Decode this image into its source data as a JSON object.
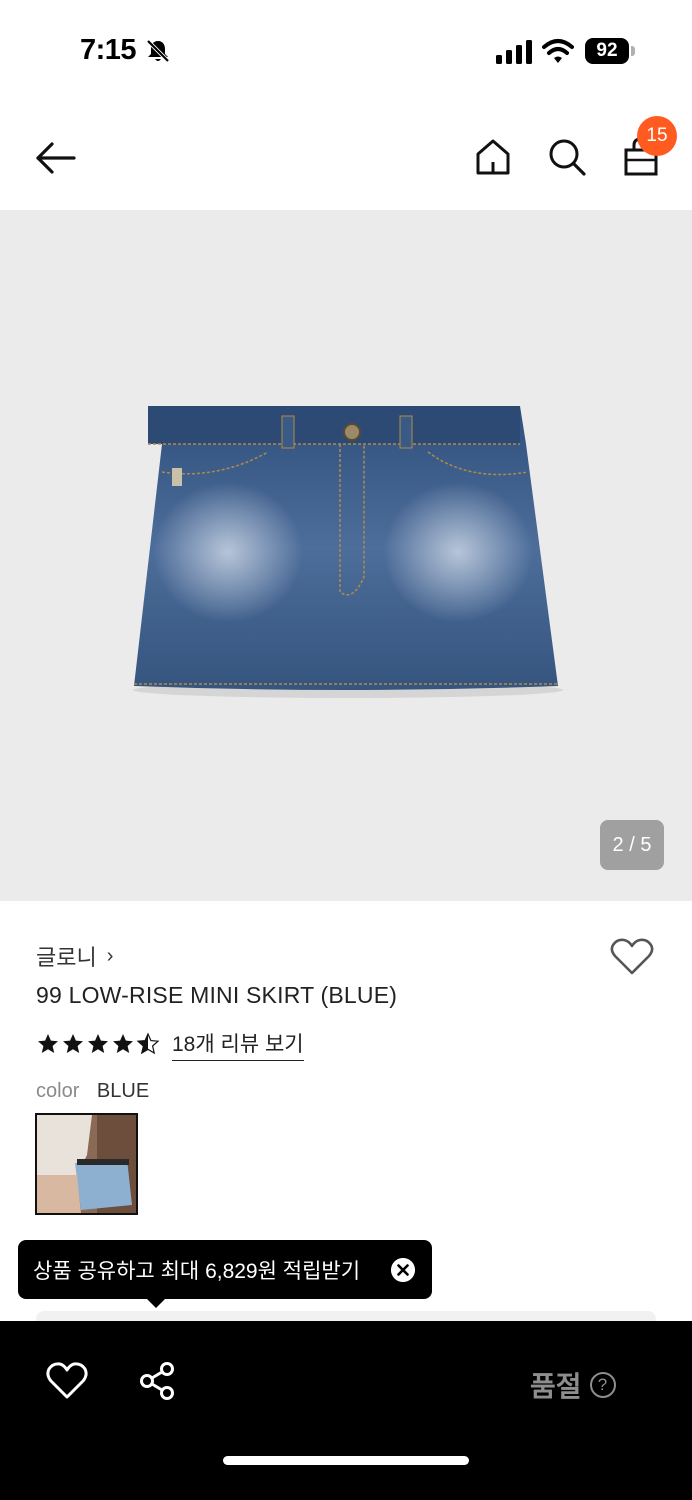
{
  "status_bar": {
    "time": "7:15",
    "battery": "92"
  },
  "header": {
    "cart_count": "15"
  },
  "gallery": {
    "indicator": "2 / 5"
  },
  "product": {
    "brand": "글로니",
    "brand_chevron": "›",
    "name": "99 LOW-RISE MINI SKIRT (BLUE)",
    "rating": 4.5,
    "review_link": "18개 리뷰 보기",
    "color_label": "color",
    "color_value": "BLUE"
  },
  "tooltip": {
    "text": "상품 공유하고 최대 6,829원 적립받기"
  },
  "bottom_bar": {
    "status": "품절",
    "help": "?"
  },
  "colors": {
    "badge": "#ff5a1f",
    "image_bg": "#ebebeb",
    "bottom_bar": "#000000",
    "soldout_text": "#8e8e8e"
  },
  "icons": [
    "bell-slash-icon",
    "signal-icon",
    "wifi-icon",
    "battery-icon",
    "back-arrow-icon",
    "home-icon",
    "search-icon",
    "shopping-bag-icon",
    "heart-icon",
    "star-icon",
    "close-icon",
    "share-icon",
    "help-icon"
  ]
}
